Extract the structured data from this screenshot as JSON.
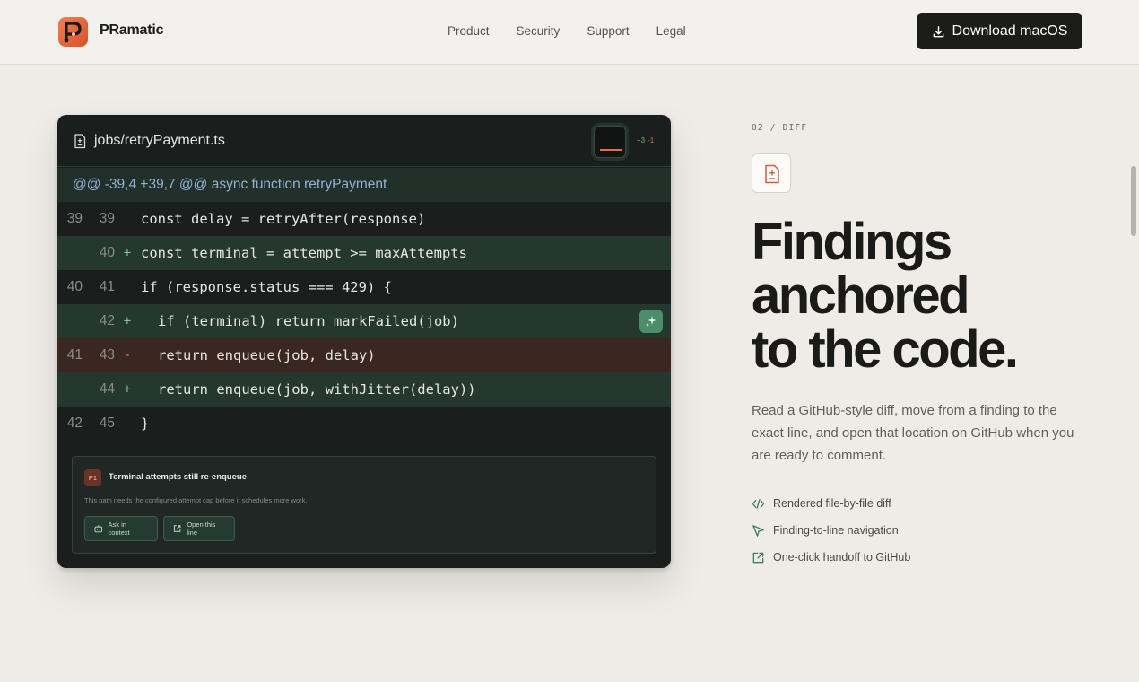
{
  "header": {
    "brand": "PRamatic",
    "nav": [
      "Product",
      "Security",
      "Support",
      "Legal"
    ],
    "download_label": "Download macOS"
  },
  "diff_panel": {
    "file_name": "jobs/retryPayment.ts",
    "additions": "+3",
    "deletions": "-1",
    "hunk_header": "@@ -39,4 +39,7 @@ async function retryPayment",
    "lines": [
      {
        "old": "39",
        "new": "39",
        "sign": "",
        "type": "ctx",
        "indent": false,
        "code": "const delay = retryAfter(response)"
      },
      {
        "old": "",
        "new": "40",
        "sign": "+",
        "type": "add",
        "indent": false,
        "code": "const terminal = attempt >= maxAttempts"
      },
      {
        "old": "40",
        "new": "41",
        "sign": "",
        "type": "ctx",
        "indent": false,
        "code": "if (response.status === 429) {"
      },
      {
        "old": "",
        "new": "42",
        "sign": "+",
        "type": "add",
        "indent": true,
        "code": "if (terminal) return markFailed(job)"
      },
      {
        "old": "41",
        "new": "43",
        "sign": "-",
        "type": "del",
        "indent": true,
        "code": "return enqueue(job, delay)"
      },
      {
        "old": "",
        "new": "44",
        "sign": "+",
        "type": "add",
        "indent": true,
        "code": "return enqueue(job, withJitter(delay))"
      },
      {
        "old": "42",
        "new": "45",
        "sign": "",
        "type": "ctx",
        "indent": false,
        "code": "}"
      }
    ],
    "finding": {
      "priority": "P1",
      "title": "Terminal attempts still re-enqueue",
      "body": "This path needs the configured attempt cap before it schedules more work.",
      "ask_label": "Ask in context",
      "open_label": "Open this line"
    }
  },
  "section": {
    "eyebrow": "02 / DIFF",
    "headline": [
      "Findings",
      "anchored",
      "to the code."
    ],
    "lede": "Read a GitHub-style diff, move from a finding to the exact line, and open that location on GitHub when you are ready to comment.",
    "features": [
      {
        "icon": "code-brackets-icon",
        "label": "Rendered file-by-file diff"
      },
      {
        "icon": "cursor-arrow-icon",
        "label": "Finding-to-line navigation"
      },
      {
        "icon": "external-link-icon",
        "label": "One-click handoff to GitHub"
      }
    ]
  },
  "colors": {
    "accent": "#e07446",
    "add_bg": "#24382f",
    "del_bg": "#3a2722",
    "panel_bg": "#1a1e1d"
  }
}
